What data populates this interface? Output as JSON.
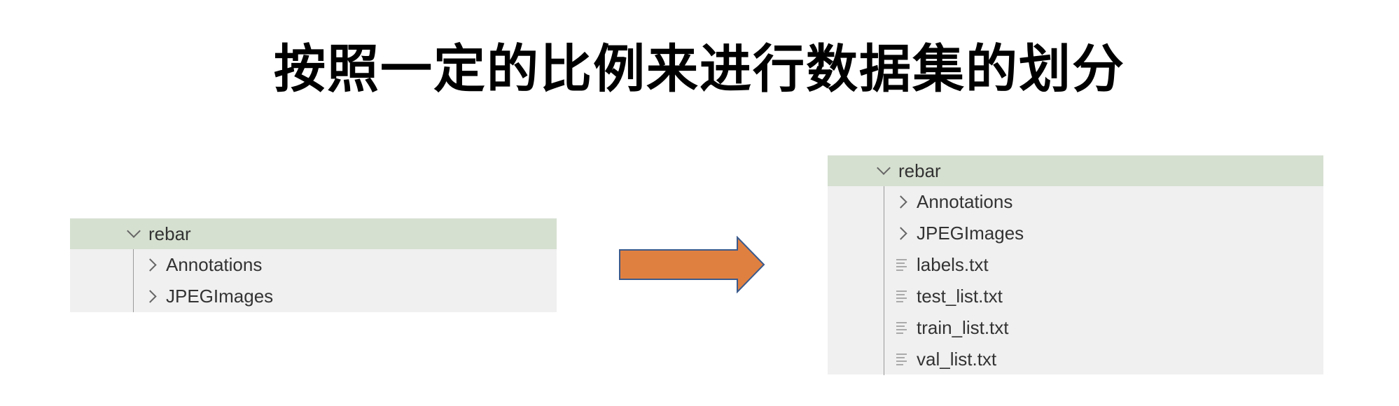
{
  "title": "按照一定的比例来进行数据集的划分",
  "before": {
    "root": "rebar",
    "children": [
      "Annotations",
      "JPEGImages"
    ]
  },
  "after": {
    "root": "rebar",
    "folders": [
      "Annotations",
      "JPEGImages"
    ],
    "files": [
      "labels.txt",
      "test_list.txt",
      "train_list.txt",
      "val_list.txt"
    ]
  },
  "colors": {
    "root_row_bg": "#d6e0d0",
    "panel_bg": "#f0f0f0",
    "arrow_fill": "#e08040",
    "arrow_stroke": "#3a5a8c"
  },
  "icons": {
    "expanded": "chevron-down-icon",
    "collapsed": "chevron-right-icon",
    "file": "text-file-icon",
    "arrow": "right-arrow-icon"
  }
}
